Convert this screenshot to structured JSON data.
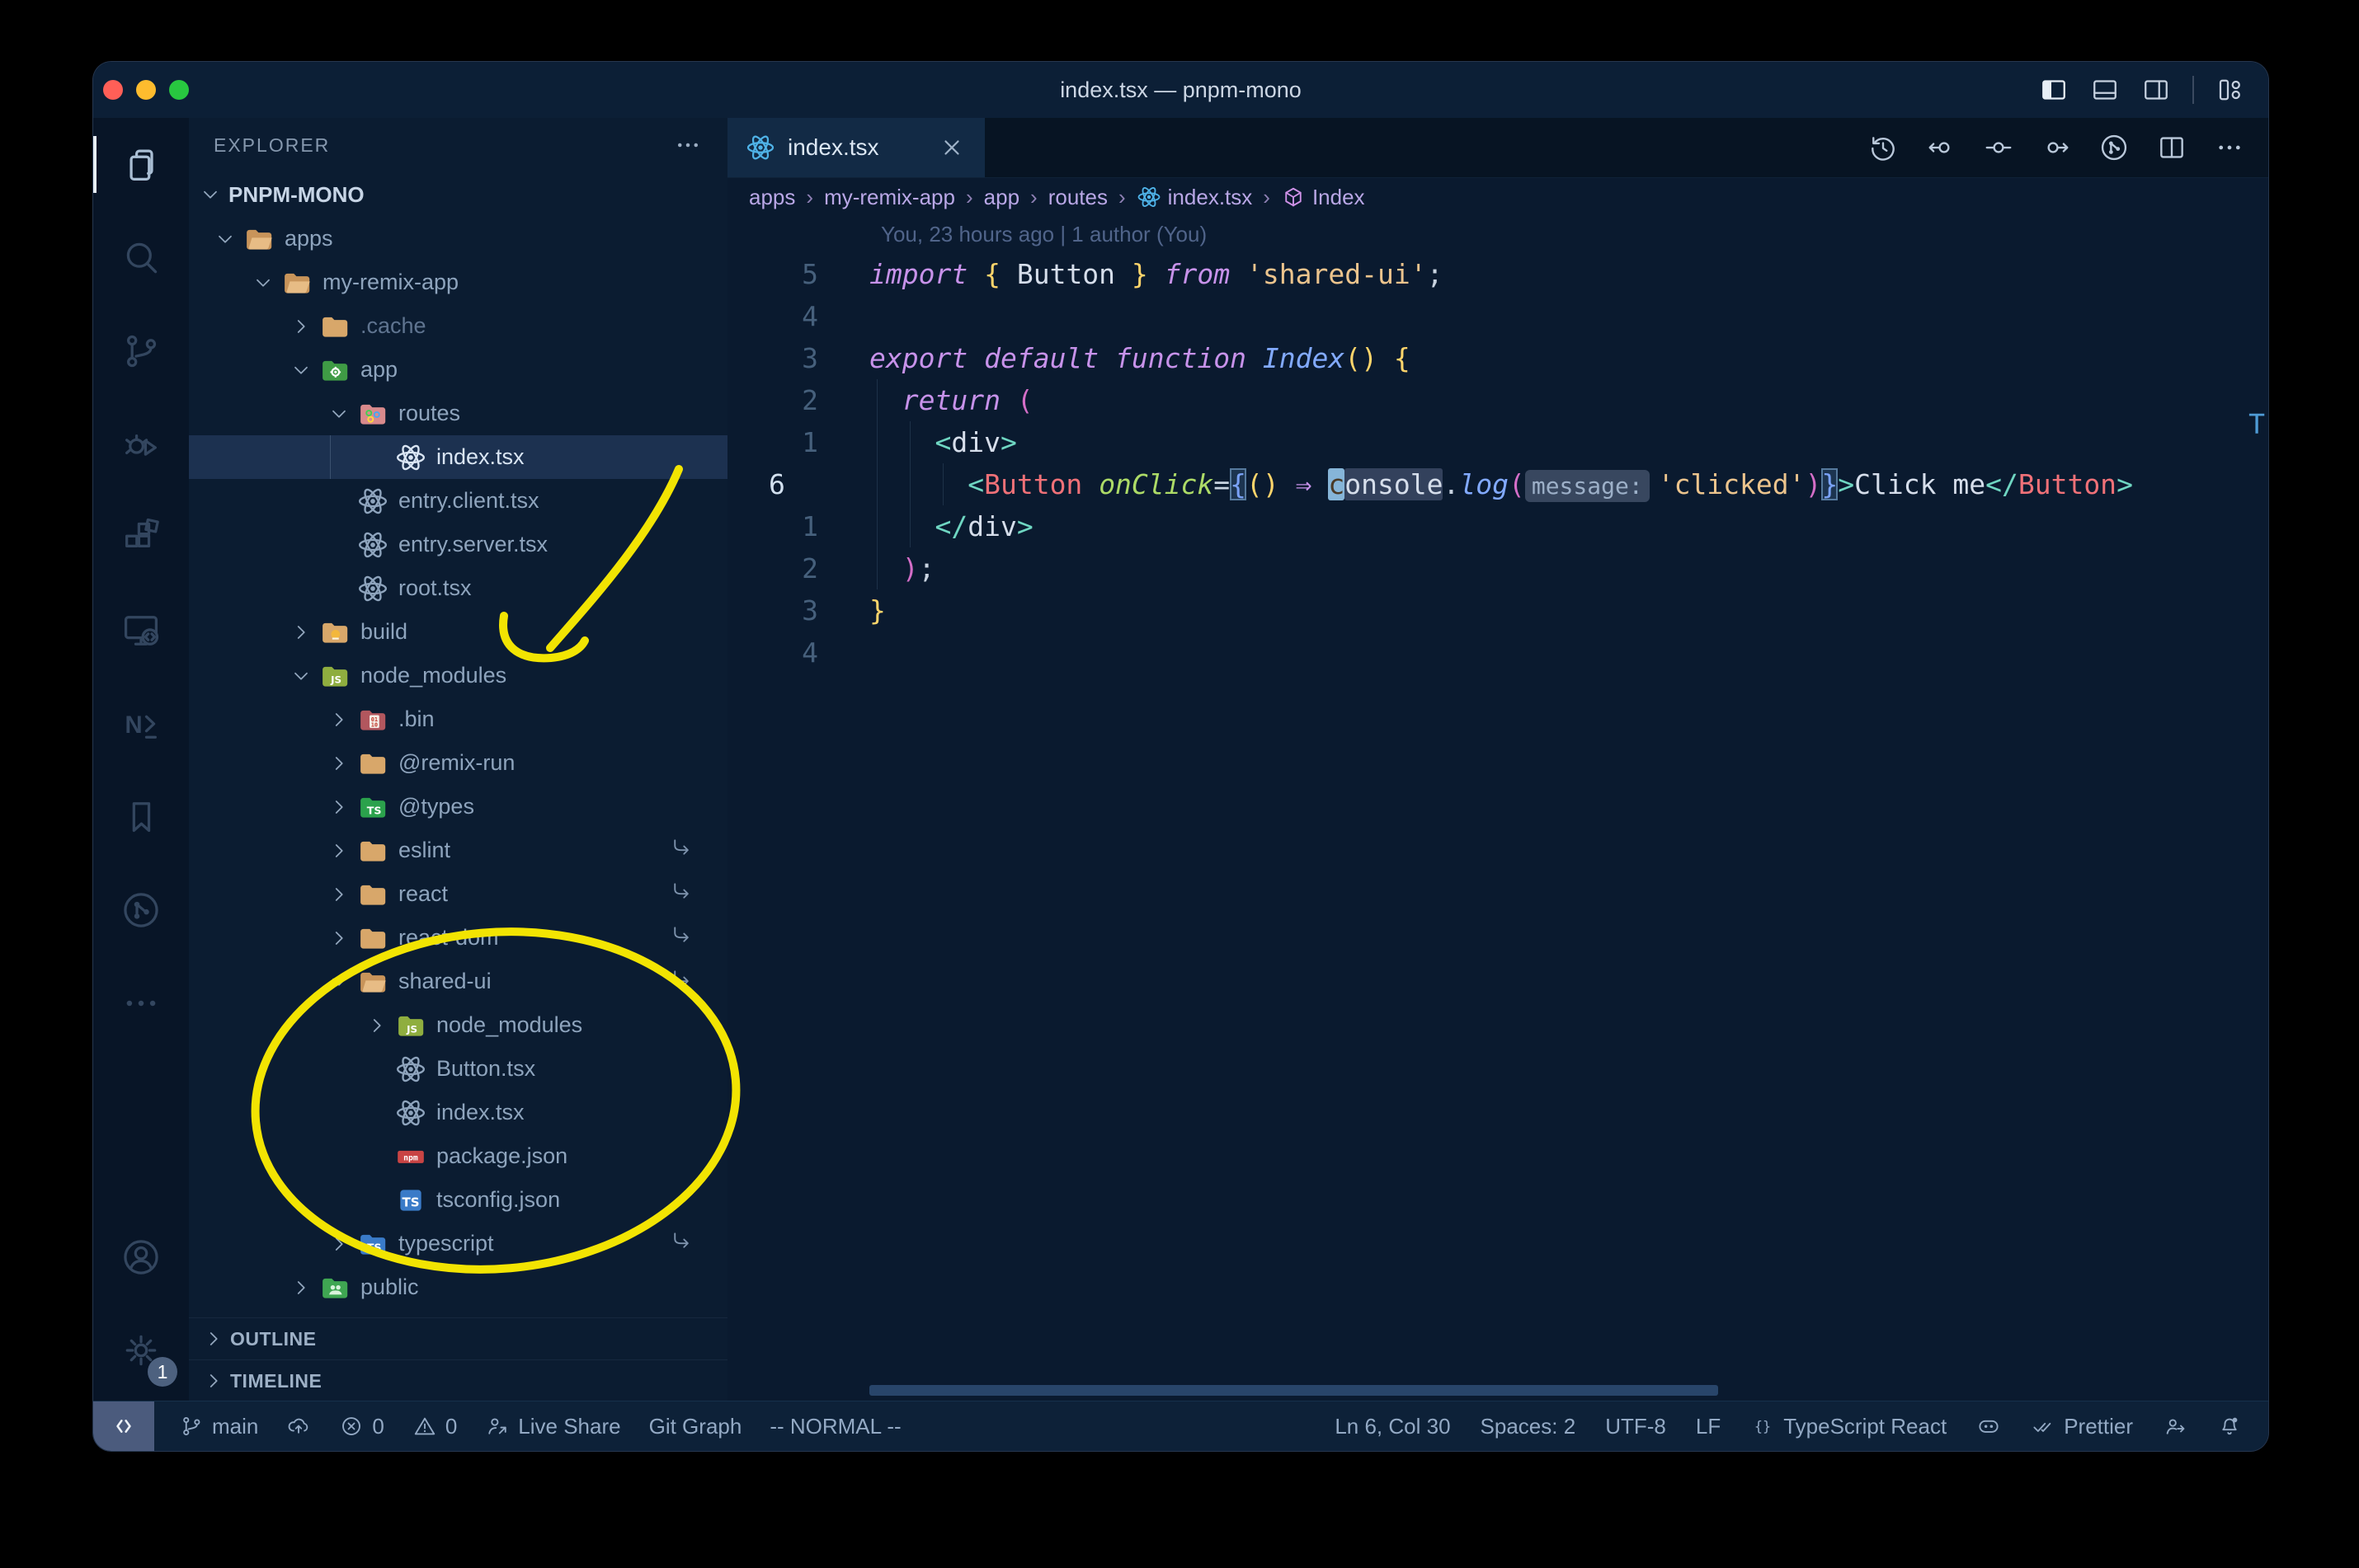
{
  "window": {
    "title": "index.tsx — pnpm-mono"
  },
  "titlebar": {
    "icons": [
      "layout-sidebar-left",
      "layout-panel",
      "layout-sidebar-right",
      "customize-layout"
    ]
  },
  "activity_bar": {
    "top": [
      {
        "name": "explorer",
        "icon": "files",
        "active": true
      },
      {
        "name": "search",
        "icon": "search",
        "active": false
      },
      {
        "name": "source-control",
        "icon": "branch",
        "active": false
      },
      {
        "name": "run-debug",
        "icon": "debug",
        "active": false
      },
      {
        "name": "extensions",
        "icon": "extensions",
        "active": false
      },
      {
        "name": "remote-explorer",
        "icon": "remote-explorer",
        "active": false
      },
      {
        "name": "nx-console",
        "icon": "nx",
        "active": false
      },
      {
        "name": "bookmarks",
        "icon": "bookmark",
        "active": false
      },
      {
        "name": "git-graph",
        "icon": "gitgraph",
        "active": false
      },
      {
        "name": "more-views",
        "icon": "more",
        "active": false
      }
    ],
    "bottom": [
      {
        "name": "accounts",
        "icon": "account"
      },
      {
        "name": "settings",
        "icon": "gear",
        "badge": "1"
      }
    ]
  },
  "explorer": {
    "title": "EXPLORER",
    "root": "PNPM-MONO",
    "items": [
      {
        "label": "apps",
        "depth": 0,
        "chevron": "down",
        "icon": "folder-open-tan"
      },
      {
        "label": "my-remix-app",
        "depth": 1,
        "chevron": "down",
        "icon": "folder-open-tan"
      },
      {
        "label": ".cache",
        "depth": 2,
        "chevron": "right",
        "icon": "folder-tan",
        "dim": true
      },
      {
        "label": "app",
        "depth": 2,
        "chevron": "down",
        "icon": "folder-app"
      },
      {
        "label": "routes",
        "depth": 3,
        "chevron": "down",
        "icon": "folder-routes"
      },
      {
        "label": "index.tsx",
        "depth": 4,
        "chevron": "none",
        "icon": "react",
        "selected": true
      },
      {
        "label": "entry.client.tsx",
        "depth": 3,
        "chevron": "none",
        "icon": "react"
      },
      {
        "label": "entry.server.tsx",
        "depth": 3,
        "chevron": "none",
        "icon": "react"
      },
      {
        "label": "root.tsx",
        "depth": 3,
        "chevron": "none",
        "icon": "react"
      },
      {
        "label": "build",
        "depth": 2,
        "chevron": "right",
        "icon": "folder-build"
      },
      {
        "label": "node_modules",
        "depth": 2,
        "chevron": "down",
        "icon": "folder-nm"
      },
      {
        "label": ".bin",
        "depth": 3,
        "chevron": "right",
        "icon": "folder-bin"
      },
      {
        "label": "@remix-run",
        "depth": 3,
        "chevron": "right",
        "icon": "folder-tan"
      },
      {
        "label": "@types",
        "depth": 3,
        "chevron": "right",
        "icon": "folder-types"
      },
      {
        "label": "eslint",
        "depth": 3,
        "chevron": "right",
        "icon": "folder-tan",
        "symlink": true
      },
      {
        "label": "react",
        "depth": 3,
        "chevron": "right",
        "icon": "folder-tan",
        "symlink": true
      },
      {
        "label": "react-dom",
        "depth": 3,
        "chevron": "right",
        "icon": "folder-tan",
        "symlink": true
      },
      {
        "label": "shared-ui",
        "depth": 3,
        "chevron": "down",
        "icon": "folder-open-tan",
        "symlink": true
      },
      {
        "label": "node_modules",
        "depth": 4,
        "chevron": "right",
        "icon": "folder-nm"
      },
      {
        "label": "Button.tsx",
        "depth": 4,
        "chevron": "none",
        "icon": "react"
      },
      {
        "label": "index.tsx",
        "depth": 4,
        "chevron": "none",
        "icon": "react"
      },
      {
        "label": "package.json",
        "depth": 4,
        "chevron": "none",
        "icon": "npm"
      },
      {
        "label": "tsconfig.json",
        "depth": 4,
        "chevron": "none",
        "icon": "tsjson"
      },
      {
        "label": "typescript",
        "depth": 3,
        "chevron": "right",
        "icon": "folder-ts",
        "symlink": true
      },
      {
        "label": "public",
        "depth": 2,
        "chevron": "right",
        "icon": "folder-public"
      }
    ],
    "sections": [
      "OUTLINE",
      "TIMELINE"
    ]
  },
  "editor": {
    "tab": {
      "label": "index.tsx",
      "icon": "react"
    },
    "actions": [
      "history",
      "prev-change",
      "commit",
      "next-change",
      "gitgraph",
      "split-editor",
      "more"
    ],
    "breadcrumbs": {
      "separator": "›",
      "items": [
        {
          "label": "apps"
        },
        {
          "label": "my-remix-app"
        },
        {
          "label": "app"
        },
        {
          "label": "routes"
        },
        {
          "label": "index.tsx",
          "icon": "react"
        },
        {
          "label": "Index",
          "icon": "symbol-box"
        }
      ]
    },
    "blame": "You, 23 hours ago | 1 author (You)",
    "lines": [
      {
        "gutter": "5",
        "current": false,
        "tokens": [
          [
            "kw",
            "import"
          ],
          [
            "ws",
            " "
          ],
          [
            "brY",
            "{"
          ],
          [
            "id",
            " Button "
          ],
          [
            "brY",
            "}"
          ],
          [
            "ws",
            " "
          ],
          [
            "kw",
            "from"
          ],
          [
            "ws",
            " "
          ],
          [
            "str",
            "'shared-ui'"
          ],
          [
            "punc",
            ";"
          ]
        ]
      },
      {
        "gutter": "4",
        "current": false,
        "tokens": []
      },
      {
        "gutter": "3",
        "current": false,
        "tokens": [
          [
            "kw",
            "export"
          ],
          [
            "ws",
            " "
          ],
          [
            "kw",
            "default"
          ],
          [
            "ws",
            " "
          ],
          [
            "kw",
            "function"
          ],
          [
            "ws",
            " "
          ],
          [
            "fn",
            "Index"
          ],
          [
            "brY",
            "()"
          ],
          [
            "ws",
            " "
          ],
          [
            "brY",
            "{"
          ]
        ]
      },
      {
        "gutter": "2",
        "current": false,
        "tokens": [
          [
            "ws",
            "  "
          ],
          [
            "kw",
            "return"
          ],
          [
            "ws",
            " "
          ],
          [
            "brP",
            "("
          ]
        ]
      },
      {
        "gutter": "1",
        "current": false,
        "tokens": [
          [
            "ws",
            "    "
          ],
          [
            "tag",
            "<"
          ],
          [
            "id",
            "div"
          ],
          [
            "tag",
            ">"
          ]
        ]
      },
      {
        "gutter": "6",
        "current": true,
        "tokens": [
          [
            "ws",
            "      "
          ],
          [
            "tag",
            "<"
          ],
          [
            "comp",
            "Button"
          ],
          [
            "ws",
            " "
          ],
          [
            "attr",
            "onClick"
          ],
          [
            "punc",
            "="
          ],
          [
            "brB",
            "{",
            "box"
          ],
          [
            "brY",
            "()"
          ],
          [
            "ws",
            " "
          ],
          [
            "arrow",
            "⇒"
          ],
          [
            "ws",
            " "
          ],
          [
            "id",
            "c",
            "cursor"
          ],
          [
            "id",
            "onsole",
            "hl"
          ],
          [
            "punc",
            "."
          ],
          [
            "fn",
            "log"
          ],
          [
            "brP",
            "("
          ],
          [
            "inlay",
            "message:",
            "inlay"
          ],
          [
            "str",
            "'clicked'"
          ],
          [
            "brP",
            ")"
          ],
          [
            "brB",
            "}",
            "box"
          ],
          [
            "tag",
            ">"
          ],
          [
            "id",
            "Click me"
          ],
          [
            "tag",
            "</"
          ],
          [
            "comp",
            "Button"
          ],
          [
            "tag",
            ">"
          ]
        ]
      },
      {
        "gutter": "1",
        "current": false,
        "tokens": [
          [
            "ws",
            "    "
          ],
          [
            "tag",
            "</"
          ],
          [
            "id",
            "div"
          ],
          [
            "tag",
            ">"
          ]
        ]
      },
      {
        "gutter": "2",
        "current": false,
        "tokens": [
          [
            "ws",
            "  "
          ],
          [
            "brP",
            ")"
          ],
          [
            "punc",
            ";"
          ]
        ]
      },
      {
        "gutter": "3",
        "current": false,
        "tokens": [
          [
            "brY",
            "}"
          ]
        ]
      },
      {
        "gutter": "4",
        "current": false,
        "tokens": []
      }
    ],
    "edge_artifact": "T"
  },
  "status_bar": {
    "left": [
      {
        "icon": "remote",
        "chip": true
      },
      {
        "icon": "branch",
        "label": "main"
      },
      {
        "icon": "cloud-upload"
      },
      {
        "icon": "error",
        "label": "0"
      },
      {
        "icon": "warning",
        "label": "0"
      },
      {
        "icon": "live-share",
        "label": "Live Share"
      },
      {
        "label": "Git Graph"
      },
      {
        "label": "-- NORMAL --"
      }
    ],
    "right": [
      {
        "label": "Ln 6, Col 30"
      },
      {
        "label": "Spaces: 2"
      },
      {
        "label": "UTF-8"
      },
      {
        "label": "LF"
      },
      {
        "icon": "braces",
        "label": "TypeScript React"
      },
      {
        "icon": "copilot"
      },
      {
        "icon": "double-check",
        "label": "Prettier"
      },
      {
        "icon": "feedback"
      },
      {
        "icon": "bell"
      }
    ]
  },
  "annotations": {
    "color": "#f2e402",
    "shapes": [
      "arrow-to-node_modules",
      "circle-around-shared-ui"
    ]
  },
  "theme": {
    "desktop_bg": "#000000",
    "window_bg": "#0a1a2f",
    "titlebar_bg": "#0c1f36",
    "sidebar_bg": "#0b1c31",
    "activitybar_bg": "#081527",
    "statusbar_bg": "#0d2138",
    "selection_bg": "#1c3150",
    "tab_active_bg": "#122a45",
    "traffic_red": "#ff5f57",
    "traffic_yellow": "#febc2e",
    "traffic_green": "#28c840",
    "keyword": "#c792ea",
    "string": "#ecc48d",
    "component": "#f07178",
    "tag_punct": "#6fd6c2",
    "attribute": "#addb67",
    "function_name": "#82aaff",
    "bracket_yellow": "#ffd56b",
    "bracket_pink": "#d46ec8",
    "bracket_blue": "#7aa2f7",
    "breadcrumb": "#b9a7e6",
    "annotation_yellow": "#f2e402"
  }
}
